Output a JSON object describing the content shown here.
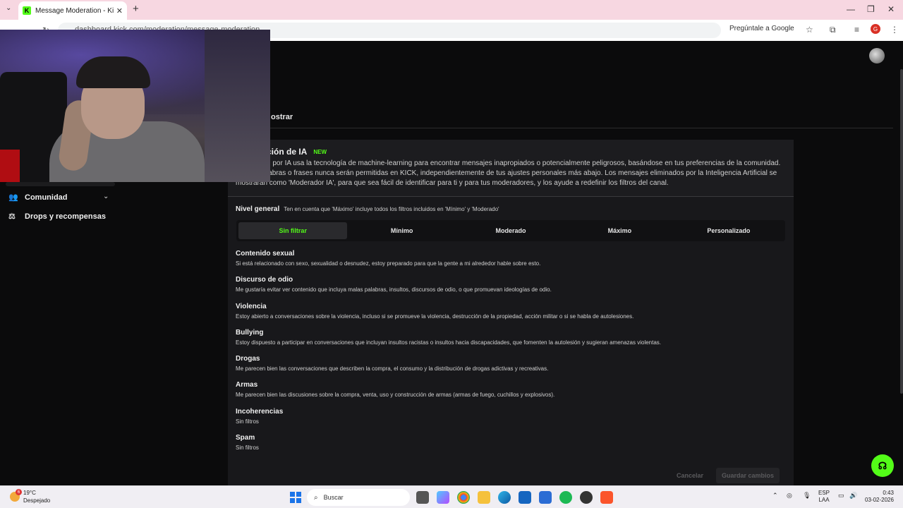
{
  "browser": {
    "tab_title": "Message Moderation - Kick Da",
    "url": "dashboard.kick.com/moderation/message-moderation",
    "ask_google": "Pregúntale a Google",
    "profile_letter": "G"
  },
  "page": {
    "tab_partial": "ostrar",
    "sidebar": [
      {
        "label": "Comunidad",
        "icon": "community-icon"
      },
      {
        "label": "Drops y recompensas",
        "icon": "drops-icon"
      }
    ],
    "panel": {
      "title": "ción de IA",
      "badge": "NEW",
      "description": [
        "n por IA usa la tecnología de machine-learning para encontrar mensajes inapropiados o potencialmente peligrosos, basándose en tus preferencias de la comunidad.",
        "labras o frases nunca serán permitidas en KICK, independientemente de tus ajustes personales más abajo. Los mensajes eliminados por la Inteligencia Artificial se",
        "mostrarán como 'Moderador IA', para que sea fácil de identificar para ti y para tus moderadores, y los ayude a redefinir los filtros del canal."
      ],
      "nivel_label": "Nivel general",
      "nivel_hint": "Ten en cuenta que 'Máximo' incluye todos los filtros incluidos en 'Mínimo' y 'Moderado'",
      "levels": [
        "Sin filtrar",
        "Mínimo",
        "Moderado",
        "Máximo",
        "Personalizado"
      ],
      "active_level": "Sin filtrar",
      "categories": [
        {
          "name": "Contenido sexual",
          "desc": "Si está relacionado con sexo, sexualidad o desnudez, estoy preparado para que la gente a mi alrededor hable sobre esto."
        },
        {
          "name": "Discurso de odio",
          "desc": "Me gustaría evitar ver contenido que incluya malas palabras, insultos, discursos de odio, o que promuevan ideologías de odio."
        },
        {
          "name": "Violencia",
          "desc": "Estoy abierto a conversaciones sobre la violencia, incluso si se promueve la violencia, destrucción de la propiedad, acción militar o si se habla de autolesiones."
        },
        {
          "name": "Bullying",
          "desc": "Estoy dispuesto a participar en conversaciones que incluyan insultos racistas o insultos hacia discapacidades, que fomenten la autolesión y sugieran amenazas violentas."
        },
        {
          "name": "Drogas",
          "desc": "Me parecen bien las conversaciones que describen la compra, el consumo y la distribución de drogas adictivas y recreativas."
        },
        {
          "name": "Armas",
          "desc": "Me parecen bien las discusiones sobre la compra, venta, uso y construcción de armas (armas de fuego, cuchillos y explosivos)."
        },
        {
          "name": "Incoherencias",
          "desc": "Sin filtros"
        },
        {
          "name": "Spam",
          "desc": "Sin filtros"
        }
      ],
      "cancel": "Cancelar",
      "save": "Guardar cambios"
    }
  },
  "taskbar": {
    "temp": "19°C",
    "weather": "Despejado",
    "weather_badge": "6",
    "search": "Buscar",
    "lang1": "ESP",
    "lang2": "LAA",
    "time": "0:43",
    "date": "03-02-2026"
  },
  "colors": {
    "accent": "#53fc18"
  }
}
